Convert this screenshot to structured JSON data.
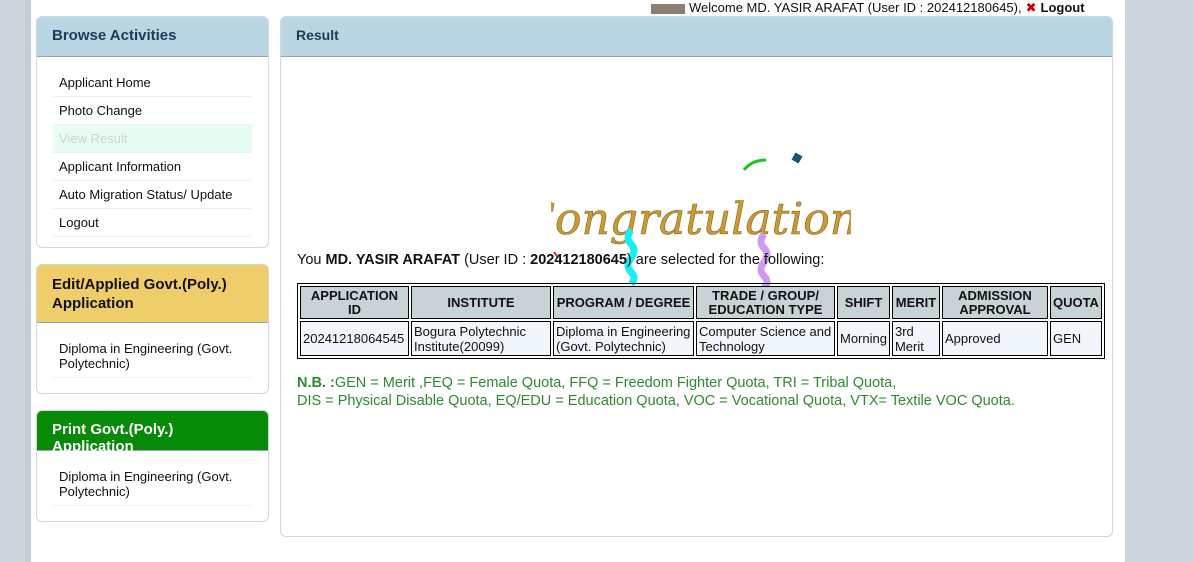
{
  "header": {
    "welcome": "Welcome MD. YASIR ARAFAT (User ID : 202412180645),",
    "logout": "Logout"
  },
  "sidebar": {
    "browse": {
      "title": "Browse Activities",
      "items": [
        {
          "label": "Applicant Home"
        },
        {
          "label": "Photo Change"
        },
        {
          "label": "View Result",
          "active": true
        },
        {
          "label": "Applicant Information"
        },
        {
          "label": "Auto Migration Status/ Update"
        },
        {
          "label": "Logout"
        }
      ]
    },
    "edit": {
      "title": "Edit/Applied Govt.(Poly.) Application",
      "items": [
        {
          "label": "Diploma in Engineering (Govt. Polytechnic)"
        }
      ]
    },
    "print": {
      "title": "Print Govt.(Poly.) Application",
      "items": [
        {
          "label": "Diploma in Engineering (Govt. Polytechnic)"
        }
      ]
    }
  },
  "result": {
    "title": "Result",
    "banner": "Congratulations",
    "sentence": {
      "pre": "You ",
      "name": "MD. YASIR ARAFAT",
      "mid": " (User ID : ",
      "uid": "202412180645",
      "post": ") are selected for the following:"
    },
    "table": {
      "headers": [
        "APPLICATION ID",
        "INSTITUTE",
        "PROGRAM / DEGREE",
        "TRADE / GROUP/ EDUCATION TYPE",
        "SHIFT",
        "MERIT",
        "ADMISSION APPROVAL",
        "QUOTA"
      ],
      "row": [
        "20241218064545",
        "Bogura Polytechnic Institute(20099)",
        "Diploma in Engineering (Govt. Polytechnic)",
        "Computer Science and Technology",
        "Morning",
        "3rd Merit",
        "Approved",
        "GEN"
      ]
    },
    "nb": {
      "label": "N.B. :",
      "line1": "GEN = Merit ,FEQ = Female Quota, FFQ = Freedom Fighter Quota, TRI = Tribal Quota,",
      "line2": "DIS = Physical Disable Quota, EQ/EDU = Education Quota, VOC = Vocational Quota, VTX= Textile VOC Quota."
    }
  }
}
